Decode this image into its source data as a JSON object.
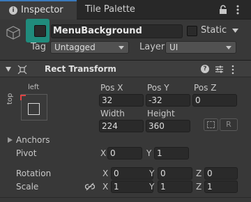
{
  "tabs": [
    {
      "label": "Inspector",
      "icon": "info-icon",
      "active": true
    },
    {
      "label": "Tile Palette",
      "active": false
    }
  ],
  "header": {
    "object_name": "MenuBackground",
    "active": false,
    "static_label": "Static",
    "tag_label": "Tag",
    "tag_value": "Untagged",
    "layer_label": "Layer",
    "layer_value": "UI",
    "active_highlight_color": "#208b7c"
  },
  "component": {
    "title": "Rect Transform",
    "anchor_preset": {
      "horizontal": "left",
      "vertical": "top"
    },
    "pos_x_label": "Pos X",
    "pos_x": "32",
    "pos_y_label": "Pos Y",
    "pos_y": "-32",
    "pos_z_label": "Pos Z",
    "pos_z": "0",
    "width_label": "Width",
    "width": "224",
    "height_label": "Height",
    "height": "360",
    "raw_button": "R",
    "anchors_label": "Anchors",
    "pivot_label": "Pivot",
    "pivot_x_label": "X",
    "pivot_x": "0",
    "pivot_y_label": "Y",
    "pivot_y": "1",
    "rotation_label": "Rotation",
    "rotation": {
      "x_label": "X",
      "x": "0",
      "y_label": "Y",
      "y": "0",
      "z_label": "Z",
      "z": "0"
    },
    "scale_label": "Scale",
    "scale": {
      "x_label": "X",
      "x": "1",
      "y_label": "Y",
      "y": "1",
      "z_label": "Z",
      "z": "1"
    }
  }
}
